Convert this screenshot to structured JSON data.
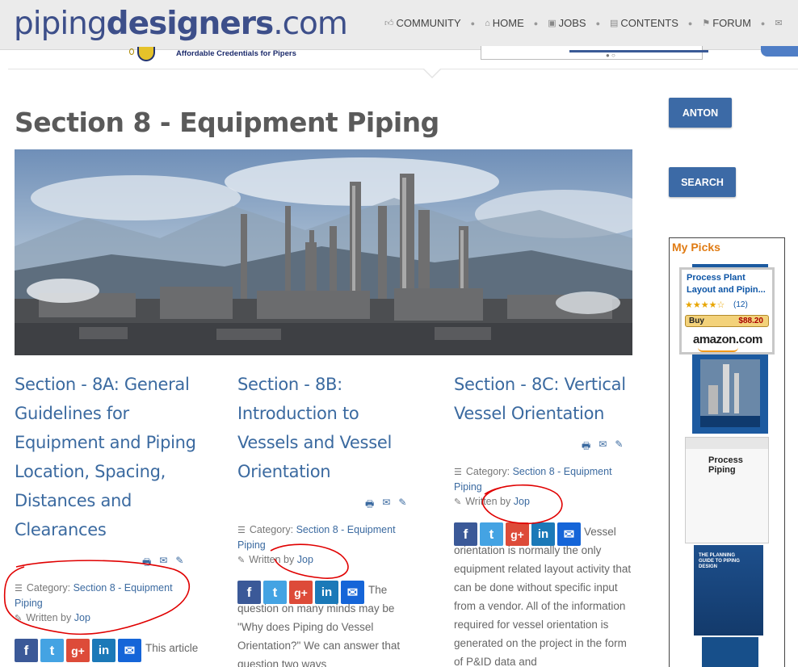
{
  "header": {
    "logo": {
      "part1": "piping",
      "part2": "designers",
      "part3": ".com"
    },
    "nav": [
      {
        "label": "COMMUNITY",
        "icon": "thumbs-up-icon"
      },
      {
        "label": "HOME",
        "icon": "home-icon"
      },
      {
        "label": "JOBS",
        "icon": "briefcase-icon"
      },
      {
        "label": "CONTENTS",
        "icon": "book-icon"
      },
      {
        "label": "FORUM",
        "icon": "flag-icon"
      }
    ],
    "tagline": "Affordable Credentials for Pipers"
  },
  "page": {
    "title": "Section 8 - Equipment Piping"
  },
  "articles": [
    {
      "title": "Section - 8A: General Guidelines for Equipment and Piping Location, Spacing, Distances and Clearances",
      "category_label": "Category:",
      "category": "Section 8 - Equipment Piping",
      "written_by_label": "Written by",
      "author": "Jop",
      "text": "This article"
    },
    {
      "title": "Section - 8B: Introduction to Vessels and Vessel Orientation",
      "category_label": "Category:",
      "category": "Section 8 - Equipment Piping",
      "written_by_label": "Written by",
      "author": "Jop",
      "text": "The question on many minds may be \"Why does Piping do Vessel Orientation?\" We can answer that question two ways"
    },
    {
      "title": "Section - 8C: Vertical Vessel Orientation",
      "category_label": "Category:",
      "category": "Section 8 - Equipment Piping",
      "written_by_label": "Written by",
      "author": "Jop",
      "text": "Vessel orientation is normally the only equipment related layout activity that can be done without specific input from a vendor. All of the information required for vessel orientation is generated on the project in the form of P&ID data and"
    }
  ],
  "sidebar": {
    "button1": "ANTON",
    "button2": "SEARCH",
    "picks_title": "My Picks",
    "amazon": {
      "title": "Process Plant Layout and Pipin...",
      "stars": "★★★★☆",
      "reviews": "(12)",
      "buy_label": "Buy",
      "price": "$88.20",
      "store": "amazon.com"
    },
    "book2_title": "Process Piping",
    "book3_title": "THE PLANNING GUIDE TO PIPING DESIGN"
  },
  "colors": {
    "link": "#3b6aa0",
    "button": "#3c6aa6",
    "annotation": "#e00000"
  }
}
